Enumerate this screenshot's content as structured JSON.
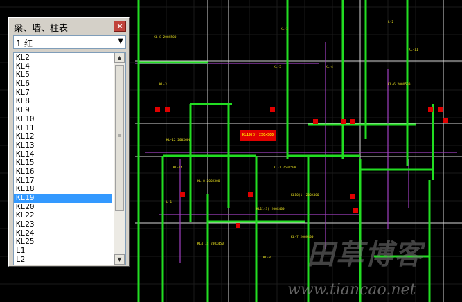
{
  "panel": {
    "title": "梁、墙、柱表",
    "close_glyph": "×",
    "combo_value": "1-红",
    "combo_arrow_glyph": "▼",
    "items": [
      "KL2",
      "KL4",
      "KL5",
      "KL6",
      "KL7",
      "KL8",
      "KL9",
      "KL10",
      "KL11",
      "KL12",
      "KL13",
      "KL14",
      "KL15",
      "KL16",
      "KL17",
      "KL18",
      "KL19",
      "KL20",
      "KL22",
      "KL23",
      "KL24",
      "KL25",
      "L1",
      "L2"
    ],
    "selected_item": "KL19",
    "scroll_up_glyph": "▲",
    "scroll_down_glyph": "▼",
    "scroll_grip_glyph": "≡"
  },
  "drawing": {
    "highlight_label": "KL19(3) 250×500",
    "labels": [
      "KL-8 200X500",
      "KL-2",
      "KL-4",
      "KL-3",
      "KL-14",
      "KL-1 250X500",
      "KL-12 200X600",
      "KL-8 200X300",
      "KL10(1) 200X400",
      "KL4(1) 200X450",
      "KL11(3) 200X400",
      "KL-6 200X500",
      "KL-7 200X400",
      "KL-8",
      "KL-5",
      "L-1",
      "L-2",
      "KL-11"
    ],
    "colors": {
      "background": "#000000",
      "green_wall": "#22dd22",
      "purple_line": "#a040c0",
      "yellow_text": "#e8e020",
      "red_marker": "#e00000",
      "white_line": "#d8d8d8"
    }
  },
  "watermark": {
    "cn": "田草博客",
    "url": "www.tiancao.net"
  }
}
